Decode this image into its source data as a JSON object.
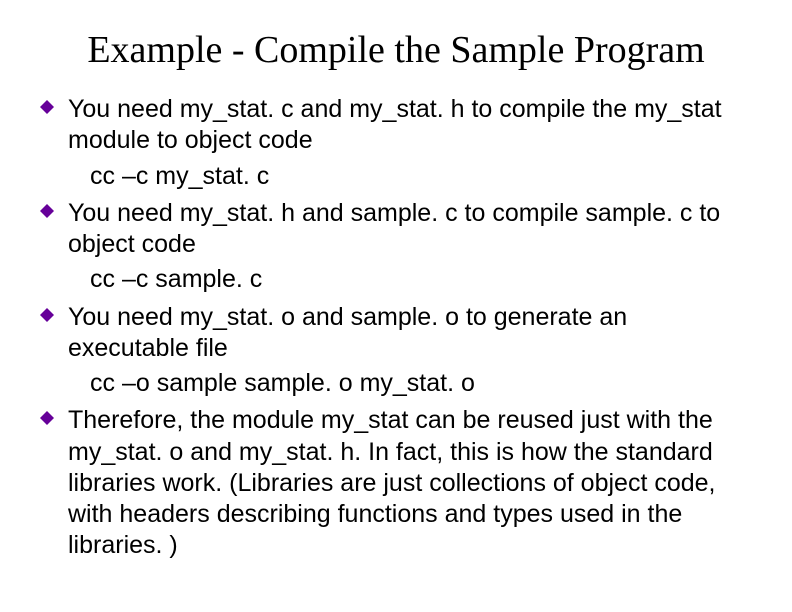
{
  "title": "Example - Compile the Sample Program",
  "items": [
    {
      "text": "You need my_stat. c and my_stat. h to compile the my_stat module to object code",
      "sub": "cc –c my_stat. c"
    },
    {
      "text": "You need my_stat. h and sample. c to compile sample. c to object code",
      "sub": "cc –c sample. c"
    },
    {
      "text": "You need my_stat. o and sample. o to generate an executable file",
      "sub": "cc –o sample sample. o my_stat. o"
    },
    {
      "text": "Therefore, the module my_stat can be reused just with the my_stat. o and my_stat. h.  In fact, this is how the standard libraries work.  (Libraries are just collections of object code, with headers describing functions and types used in the libraries. )",
      "sub": null
    }
  ]
}
